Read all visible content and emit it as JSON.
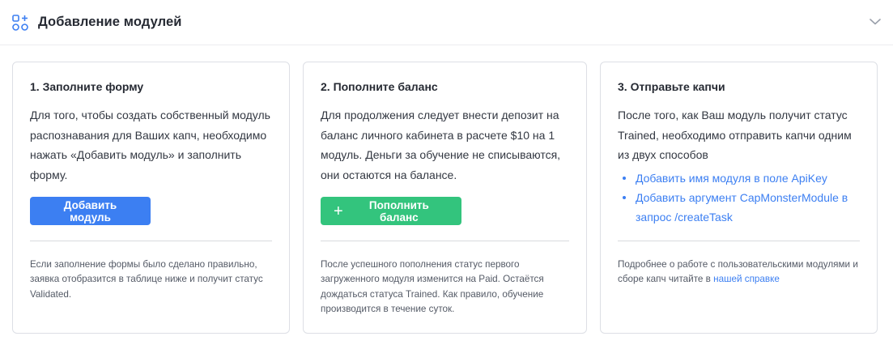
{
  "header": {
    "title": "Добавление модулей",
    "icon": "modules-add-icon",
    "collapse_icon": "chevron-down-icon"
  },
  "cards": [
    {
      "title": "1. Заполните форму",
      "text": "Для того, чтобы создать собственный модуль распознавания для Ваших капч, необходимо нажать «Добавить модуль» и заполнить форму.",
      "button_label": "Добавить модуль",
      "note": "Если заполнение формы было сделано правильно, заявка отобразится в таблице ниже и получит статус Validated."
    },
    {
      "title": "2. Пополните баланс",
      "text": "Для продолжения следует внести депозит на баланс личного кабинета в расчете $10 на 1 модуль. Деньги за обучение не списываются, они остаются на балансе.",
      "button_icon": "+",
      "button_label": "Пополнить баланс",
      "note": "После успешного пополнения статус первого загруженного модуля изменится на Paid. Остаётся дождаться статуса Trained. Как правило, обучение производится в течение суток."
    },
    {
      "title": "3. Отправьте капчи",
      "text": "После того, как Ваш модуль получит статус Trained, необходимо отправить капчи одним из двух способов",
      "links": [
        "Добавить имя модуля в поле ApiKey",
        "Добавить аргумент CapMonsterModule в запрос /createTask"
      ],
      "note_prefix": "Подробнее о работе с пользовательскими модулями и сборе капч читайте в ",
      "note_link": "нашей справке"
    }
  ],
  "colors": {
    "primary_blue": "#3c7ff2",
    "success_green": "#33c47d",
    "border": "#dddfe5"
  }
}
